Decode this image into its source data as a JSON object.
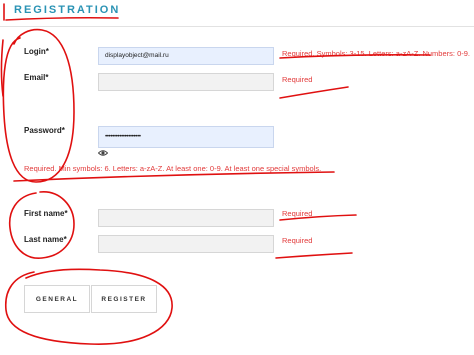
{
  "form": {
    "title": "REGISTRATION",
    "fields": {
      "login": {
        "label": "Login*",
        "value": "displayobject@mail.ru",
        "error": "Required. Symbols: 3-15. Letters: a-zA-Z. Numbers: 0-9."
      },
      "email": {
        "label": "Email*",
        "value": "",
        "error": "Required"
      },
      "password": {
        "label": "Password*",
        "value": "••••••••••••••••••••",
        "error": "Required. Min symbols: 6. Letters: a-zA-Z. At least one: 0-9. At least one special symbols."
      },
      "first_name": {
        "label": "First name*",
        "value": "",
        "error": "Required"
      },
      "last_name": {
        "label": "Last name*",
        "value": "",
        "error": "Required"
      }
    },
    "buttons": {
      "general": "GENERAL",
      "register": "REGISTER"
    }
  },
  "colors": {
    "accent": "#2a93b4",
    "error": "#e23a3a",
    "annotation": "#e01010"
  },
  "icons": {
    "password_toggle": "eye-icon"
  }
}
